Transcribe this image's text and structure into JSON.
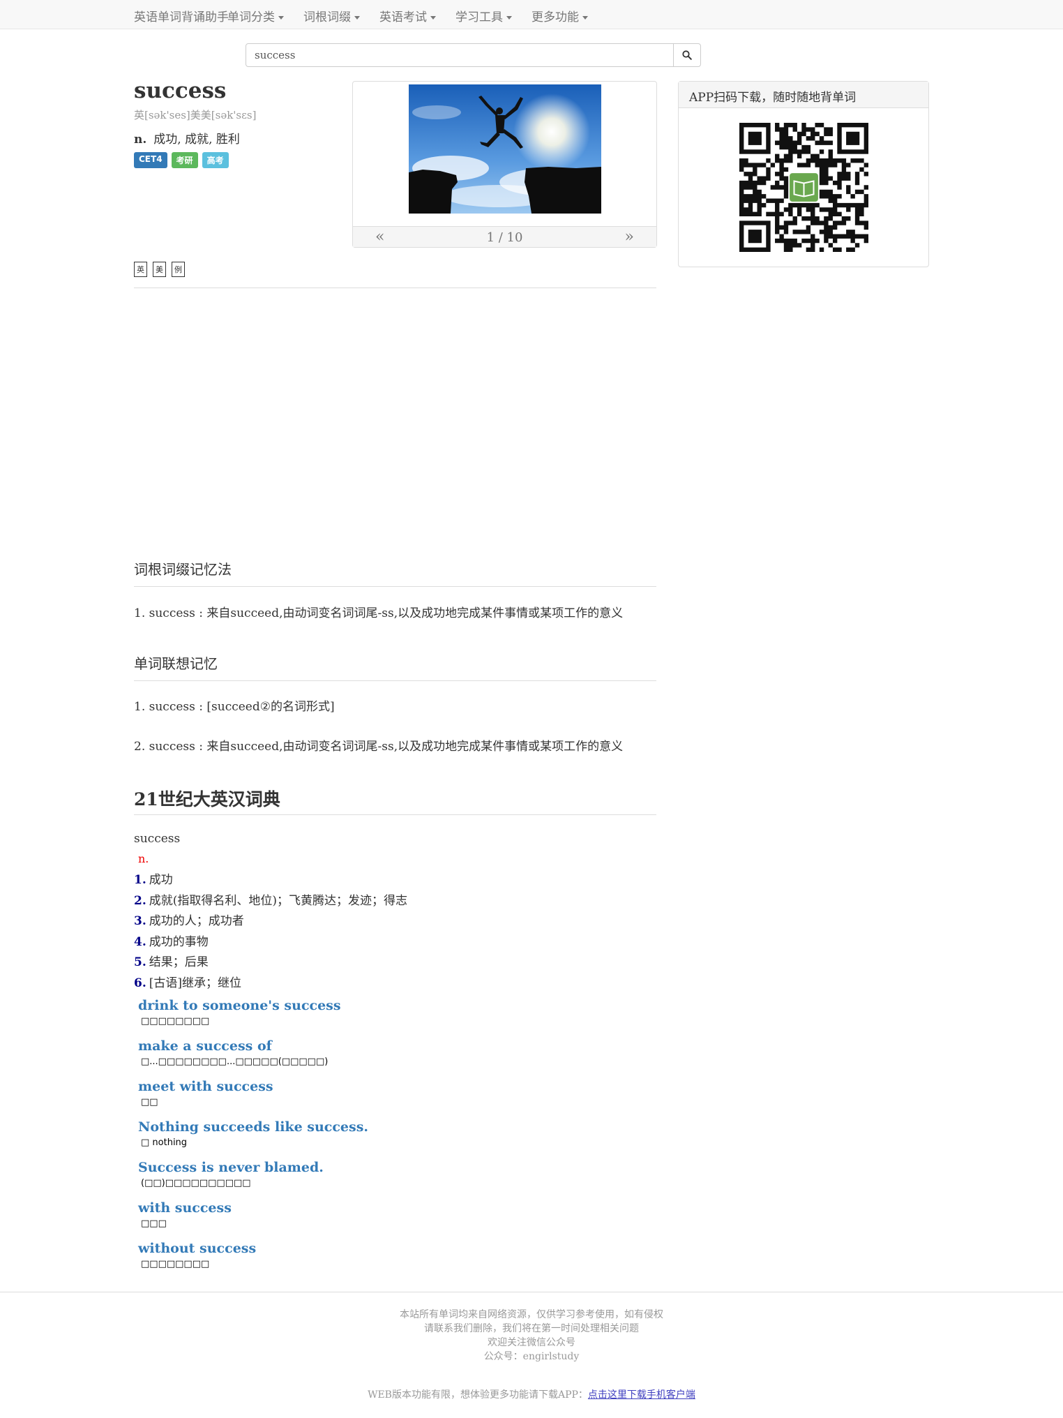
{
  "nav": {
    "brand": "英语单词背诵助手",
    "menus": [
      "单词分类",
      "词根词缀",
      "英语考试",
      "学习工具",
      "更多功能"
    ]
  },
  "search": {
    "value": "success"
  },
  "word": {
    "title": "success",
    "phonetic": "英[sək'ses]美美[sək'sɛs]",
    "pos": "n.",
    "meaning": "成功, 成就, 胜利",
    "badges": [
      {
        "label": "CET4",
        "color": "#337ab7"
      },
      {
        "label": "考研",
        "color": "#5cb85c"
      },
      {
        "label": "高考",
        "color": "#5bc0de"
      }
    ]
  },
  "image_panel": {
    "pager": "1 / 10",
    "prev": "«",
    "next": "»"
  },
  "app_panel": {
    "title": "APP扫码下载，随时随地背单词"
  },
  "tabs": [
    "英",
    "美",
    "例"
  ],
  "section1": {
    "title": "词根词缀记忆法",
    "items": [
      "1. success : 来自succeed,由动词变名词词尾-ss,以及成功地完成某件事情或某项工作的意义"
    ]
  },
  "section2": {
    "title": "单词联想记忆",
    "items": [
      "1. success : [succeed②的名词形式]",
      "2. success : 来自succeed,由动词变名词词尾-ss,以及成功地完成某件事情或某项工作的意义"
    ]
  },
  "section3": {
    "title": "21世纪大英汉词典",
    "word": "success",
    "pos": "n.",
    "senses": [
      {
        "num": "1.",
        "text": "成功"
      },
      {
        "num": "2.",
        "text": "成就(指取得名利、地位)；飞黄腾达；发迹；得志"
      },
      {
        "num": "3.",
        "text": "成功的人；成功者"
      },
      {
        "num": "4.",
        "text": "成功的事物"
      },
      {
        "num": "5.",
        "text": "结果；后果"
      },
      {
        "num": "6.",
        "text": "[古语]继承；继位"
      }
    ],
    "phrases": [
      {
        "en": "drink to someone's success",
        "cn": "□□□□□□□□"
      },
      {
        "en": "make a success of",
        "cn": "□...□□□□□□□□...□□□□□(□□□□□)"
      },
      {
        "en": "meet with success",
        "cn": "□□"
      },
      {
        "en": "Nothing succeeds like success.",
        "cn": "□ nothing"
      },
      {
        "en": "Success is never blamed.",
        "cn": "(□□)□□□□□□□□□□"
      },
      {
        "en": "with success",
        "cn": "□□□"
      },
      {
        "en": "without success",
        "cn": "□□□□□□□□"
      }
    ]
  },
  "footer": {
    "lines": [
      "本站所有单词均来自网络资源，仅供学习参考使用，如有侵权",
      "请联系我们删除，我们将在第一时间处理相关问题",
      "欢迎关注微信公众号",
      "公众号：engirlstudy"
    ],
    "bottom_text": "WEB版本功能有限，想体验更多功能请下载APP：",
    "bottom_link": "点击这里下载手机客户端"
  }
}
